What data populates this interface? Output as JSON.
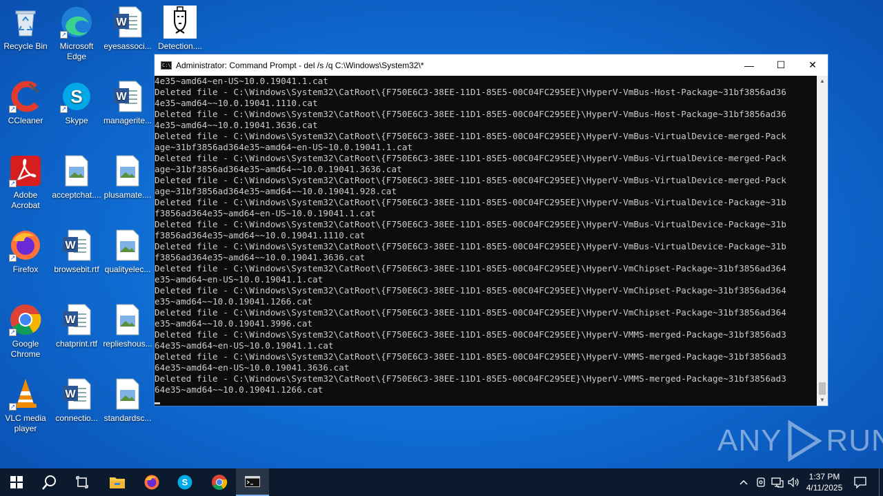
{
  "desktop": {
    "icons": [
      {
        "label": "Recycle Bin"
      },
      {
        "label": "Microsoft Edge"
      },
      {
        "label": "eyesassoci..."
      },
      {
        "label": "Detection...."
      },
      {
        "label": "CCleaner"
      },
      {
        "label": "Skype"
      },
      {
        "label": "managerite..."
      },
      {
        "label": "Adobe Acrobat"
      },
      {
        "label": "acceptchat...."
      },
      {
        "label": "plusamate...."
      },
      {
        "label": "Firefox"
      },
      {
        "label": "browsebit.rtf"
      },
      {
        "label": "qualityelec..."
      },
      {
        "label": "Google Chrome"
      },
      {
        "label": "chatprint.rtf"
      },
      {
        "label": "replieshous..."
      },
      {
        "label": "VLC media player"
      },
      {
        "label": "connectio..."
      },
      {
        "label": "standardsc..."
      }
    ]
  },
  "window": {
    "title": "Administrator: Command Prompt - del  /s /q C:\\Windows\\System32\\*",
    "minimize": "—",
    "maximize": "☐",
    "close": "✕",
    "console_text": "4e35~amd64~en-US~10.0.19041.1.cat\nDeleted file - C:\\Windows\\System32\\CatRoot\\{F750E6C3-38EE-11D1-85E5-00C04FC295EE}\\HyperV-VmBus-Host-Package~31bf3856ad36\n4e35~amd64~~10.0.19041.1110.cat\nDeleted file - C:\\Windows\\System32\\CatRoot\\{F750E6C3-38EE-11D1-85E5-00C04FC295EE}\\HyperV-VmBus-Host-Package~31bf3856ad36\n4e35~amd64~~10.0.19041.3636.cat\nDeleted file - C:\\Windows\\System32\\CatRoot\\{F750E6C3-38EE-11D1-85E5-00C04FC295EE}\\HyperV-VmBus-VirtualDevice-merged-Pack\nage~31bf3856ad364e35~amd64~en-US~10.0.19041.1.cat\nDeleted file - C:\\Windows\\System32\\CatRoot\\{F750E6C3-38EE-11D1-85E5-00C04FC295EE}\\HyperV-VmBus-VirtualDevice-merged-Pack\nage~31bf3856ad364e35~amd64~~10.0.19041.3636.cat\nDeleted file - C:\\Windows\\System32\\CatRoot\\{F750E6C3-38EE-11D1-85E5-00C04FC295EE}\\HyperV-VmBus-VirtualDevice-merged-Pack\nage~31bf3856ad364e35~amd64~~10.0.19041.928.cat\nDeleted file - C:\\Windows\\System32\\CatRoot\\{F750E6C3-38EE-11D1-85E5-00C04FC295EE}\\HyperV-VmBus-VirtualDevice-Package~31b\nf3856ad364e35~amd64~en-US~10.0.19041.1.cat\nDeleted file - C:\\Windows\\System32\\CatRoot\\{F750E6C3-38EE-11D1-85E5-00C04FC295EE}\\HyperV-VmBus-VirtualDevice-Package~31b\nf3856ad364e35~amd64~~10.0.19041.1110.cat\nDeleted file - C:\\Windows\\System32\\CatRoot\\{F750E6C3-38EE-11D1-85E5-00C04FC295EE}\\HyperV-VmBus-VirtualDevice-Package~31b\nf3856ad364e35~amd64~~10.0.19041.3636.cat\nDeleted file - C:\\Windows\\System32\\CatRoot\\{F750E6C3-38EE-11D1-85E5-00C04FC295EE}\\HyperV-VmChipset-Package~31bf3856ad364\ne35~amd64~en-US~10.0.19041.1.cat\nDeleted file - C:\\Windows\\System32\\CatRoot\\{F750E6C3-38EE-11D1-85E5-00C04FC295EE}\\HyperV-VmChipset-Package~31bf3856ad364\ne35~amd64~~10.0.19041.1266.cat\nDeleted file - C:\\Windows\\System32\\CatRoot\\{F750E6C3-38EE-11D1-85E5-00C04FC295EE}\\HyperV-VmChipset-Package~31bf3856ad364\ne35~amd64~~10.0.19041.3996.cat\nDeleted file - C:\\Windows\\System32\\CatRoot\\{F750E6C3-38EE-11D1-85E5-00C04FC295EE}\\HyperV-VMMS-merged-Package~31bf3856ad3\n64e35~amd64~en-US~10.0.19041.1.cat\nDeleted file - C:\\Windows\\System32\\CatRoot\\{F750E6C3-38EE-11D1-85E5-00C04FC295EE}\\HyperV-VMMS-merged-Package~31bf3856ad3\n64e35~amd64~en-US~10.0.19041.3636.cat\nDeleted file - C:\\Windows\\System32\\CatRoot\\{F750E6C3-38EE-11D1-85E5-00C04FC295EE}\\HyperV-VMMS-merged-Package~31bf3856ad3\n64e35~amd64~~10.0.19041.1266.cat"
  },
  "watermark": {
    "text_left": "ANY",
    "text_right": "RUN"
  },
  "taskbar": {
    "start": "windows-logo-icon",
    "search": "search-icon",
    "task_view": "task-view-icon",
    "pinned": [
      "file-explorer-icon",
      "firefox-icon",
      "skype-icon",
      "chrome-icon",
      "command-prompt-icon"
    ],
    "active_app": "command-prompt-icon"
  },
  "tray": {
    "time": "1:37 PM",
    "date": "4/11/2025"
  }
}
